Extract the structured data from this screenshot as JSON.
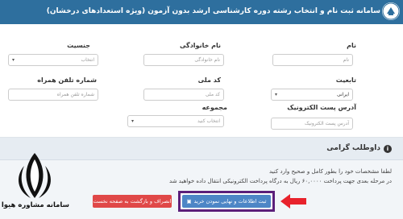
{
  "header": {
    "title": "سامانه ثبت نام و انتخاب رشته دوره کارشناسی ارشد بدون آزمون (ویژه استعدادهای درخشان)",
    "logo_icon": "university-logo-icon"
  },
  "form": {
    "name": {
      "label": "نام",
      "placeholder": "نام"
    },
    "family": {
      "label": "نام خانوادگی",
      "placeholder": "نام خانوادگی"
    },
    "gender": {
      "label": "جنسیت",
      "placeholder": "انتخاب"
    },
    "nationality": {
      "label": "تابعیت",
      "value": "ایرانی"
    },
    "national_code": {
      "label": "کد ملی",
      "placeholder": "کد ملی"
    },
    "mobile": {
      "label": "شماره تلفن همراه",
      "placeholder": "شماره تلفن همراه"
    },
    "email": {
      "label": "آدرس پست الکترونیک",
      "placeholder": "آدرس پست الکترونیک"
    },
    "group": {
      "label": "مجموعه",
      "placeholder": "انتخاب کنید"
    }
  },
  "panel": {
    "title": "داوطلب گرامی",
    "line1": "لطفا مشخصات خود را بطور کامل و صحیح وارد کنید",
    "line2": "در مرحله بعدی جهت پرداخت ۶۰,۰۰۰۰ ریال به درگاه پرداخت الکترونیکی انتقال داده خواهید شد",
    "info_icon": "info-icon",
    "info_glyph": "i"
  },
  "buttons": {
    "submit": "ثبت اطلاعات و نهایی نمودن خرید",
    "back": "انصراف و بازگشت به صفحه نخست"
  },
  "watermark": {
    "text": "سامانه مشاوره هیوا"
  },
  "colors": {
    "header": "#2e6f9e",
    "submit": "#4d86c6",
    "back": "#e04848",
    "frame": "#5b1f7a",
    "arrow": "#e8222c"
  }
}
